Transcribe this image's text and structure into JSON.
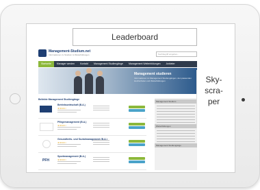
{
  "ads": {
    "leaderboard": "Leaderboard",
    "skyscraper_lines": [
      "Sky-",
      "scra-",
      "per"
    ]
  },
  "site": {
    "logo_name": "Management-Studium.net",
    "logo_tagline": "Informationen zu Studium & Weiterbildungen",
    "search_placeholder": "Suchbegriff eingeben...",
    "nav": [
      "Startseite",
      "Manager werden",
      "Kontakt",
      "Management Studiengänge",
      "Management Weiterbildungen",
      "Anbieter"
    ],
    "hero_title": "Management studieren",
    "hero_subtitle": "Informationen zu Management Studiengängen, den passenden Hochschulen und Weiterbildungen",
    "section_title": "Beliebte Management Studiengänge",
    "items": [
      {
        "name": "Betriebswirtschaft (B.A.)",
        "stars": "★★★★☆"
      },
      {
        "name": "Pflegemanagement (B.A.)",
        "stars": "★★★★☆"
      },
      {
        "name": "Gesundheits- und Sozialmanagement (B.A.)",
        "stars": "★★★★☆"
      },
      {
        "name": "Sportmanagement (B.A.)",
        "stars": "★★★★☆"
      }
    ],
    "item4_logo": "PFH",
    "sidebar_headers": [
      "Management Studium",
      "Weiterbildungen",
      "Management Studiengänge"
    ]
  }
}
